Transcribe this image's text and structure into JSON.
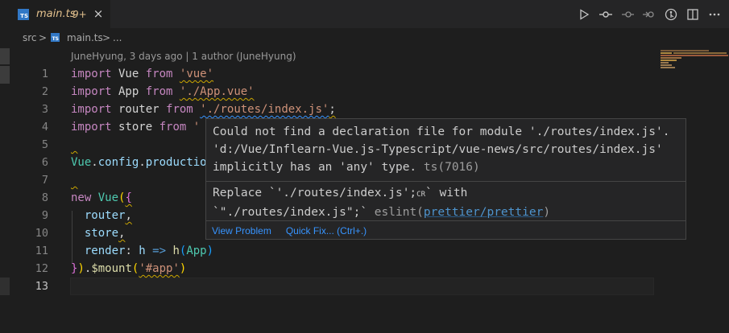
{
  "tab": {
    "label": "main.ts",
    "badge": "9+",
    "icon_label": "TS",
    "close_glyph": "×"
  },
  "tab_actions": [
    {
      "name": "run-icon"
    },
    {
      "name": "git-commit-icon"
    },
    {
      "name": "git-previous-icon"
    },
    {
      "name": "git-next-icon"
    },
    {
      "name": "timeline-icon"
    },
    {
      "name": "split-editor-icon"
    },
    {
      "name": "more-actions-icon"
    }
  ],
  "breadcrumb": {
    "folder": "src",
    "separator": ">",
    "file": "main.ts",
    "more": "..."
  },
  "codelens": "JuneHyung, 3 days ago | 1 author (JuneHyung)",
  "line_numbers": [
    "1",
    "2",
    "3",
    "4",
    "5",
    "6",
    "7",
    "8",
    "9",
    "10",
    "11",
    "12",
    "13"
  ],
  "active_line": "13",
  "code": {
    "l1": [
      "import",
      " Vue ",
      "from",
      " ",
      "'vue'"
    ],
    "l2": [
      "import",
      " App ",
      "from",
      " ",
      "'./App.vue'"
    ],
    "l3": [
      "import",
      " router ",
      "from",
      " ",
      "'./routes/index.js'",
      ";"
    ],
    "l4": [
      "import",
      " store ",
      "from",
      " ",
      "'"
    ],
    "l6": [
      "Vue",
      ".",
      "config",
      ".",
      "productio"
    ],
    "l8": [
      "new",
      " ",
      "Vue",
      "(",
      "{"
    ],
    "l9": [
      "  router",
      ","
    ],
    "l10": [
      "  store",
      ","
    ],
    "l11": [
      "  render",
      ": ",
      "h",
      " => ",
      "h",
      "(",
      "App",
      ")"
    ],
    "l12": [
      "}",
      ")",
      ".",
      "$mount",
      "(",
      "'#app'",
      ")"
    ]
  },
  "hover": {
    "line1": "Could not find a declaration file for module './routes/index.js'.",
    "line2": "'d:/Vue/Inflearn-Vue.js-Typescript/vue-news/src/routes/index.js'",
    "line3": "implicitly has an 'any' type.",
    "code1": "ts(7016)",
    "fix1": "Replace `'./routes/index.js';",
    "cr": "CR",
    "fix1b": "` with",
    "fix2": "`\"./routes/index.js\";`",
    "source": "eslint(",
    "rule_link": "prettier/prettier",
    "source_end": ")",
    "view_problem": "View Problem",
    "quick_fix": "Quick Fix... (Ctrl+.)"
  },
  "colors": {
    "accent_tab": "#e2c08d",
    "ts_blue": "#3178c6",
    "keyword": "#c586c0",
    "string": "#ce9178",
    "link": "#3794ff"
  }
}
